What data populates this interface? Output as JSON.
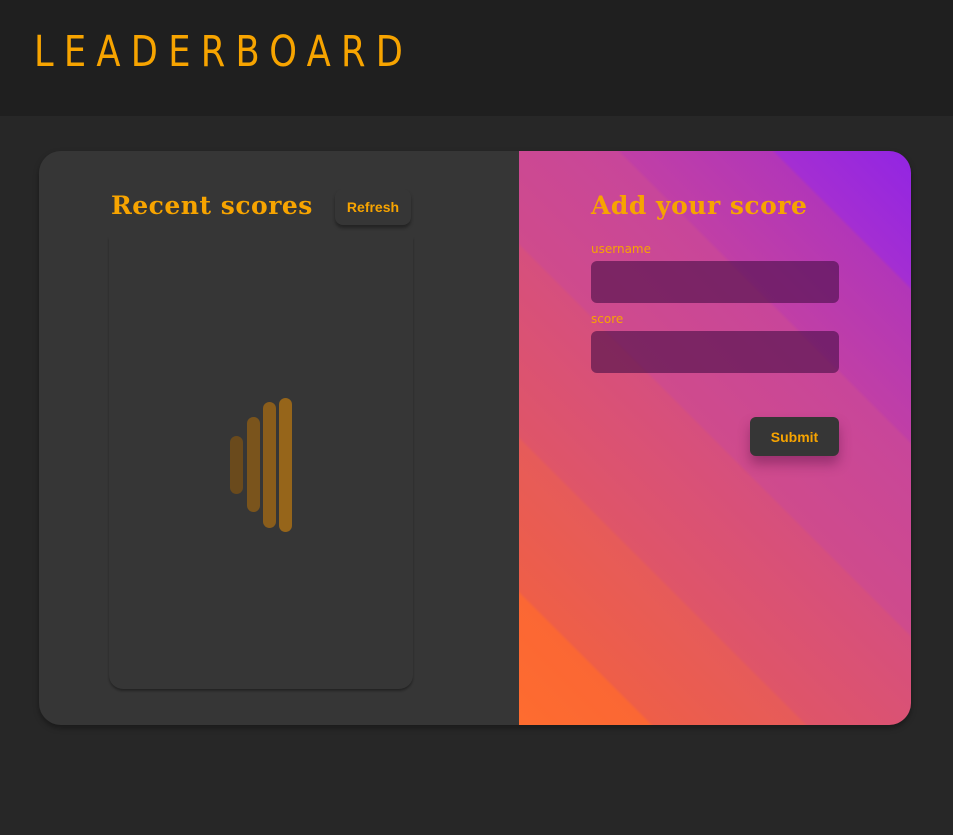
{
  "header": {
    "logo_text": "LEADERBOARD"
  },
  "recent_scores": {
    "title": "Recent scores",
    "refresh_label": "Refresh",
    "loader": {
      "icon": "loading-bars-icon",
      "color": "#f7a400"
    }
  },
  "add_score": {
    "title": "Add your score",
    "username_label": "username",
    "username_value": "",
    "score_label": "score",
    "score_value": "",
    "submit_label": "Submit"
  },
  "colors": {
    "accent": "#f7a400",
    "panel_dark": "#363636",
    "header_bg": "#1f1f1f",
    "page_bg": "#272727"
  }
}
